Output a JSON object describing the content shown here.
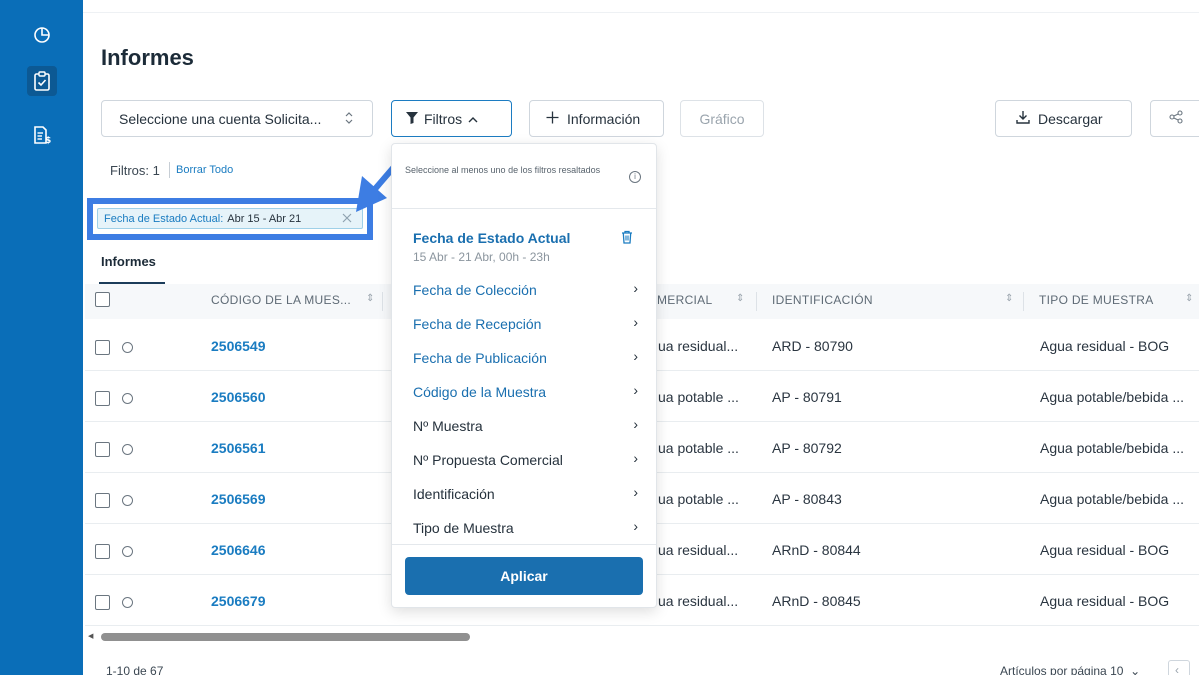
{
  "sidebar": {
    "icons": [
      "chart-pie-icon",
      "clipboard-check-icon",
      "invoice-icon"
    ]
  },
  "header": {
    "title": "Informes"
  },
  "toolbar": {
    "account_select": "Seleccione una cuenta Solicita...",
    "filters_label": "Filtros",
    "info_label": "Información",
    "chart_label": "Gráfico",
    "download_label": "Descargar"
  },
  "filters_status": {
    "label": "Filtros: 1",
    "clear_all": "Borrar Todo",
    "chip_key": "Fecha de Estado Actual:",
    "chip_value": "Abr 15 - Abr 21"
  },
  "tabs": [
    {
      "label": "Informes",
      "active": true
    }
  ],
  "table": {
    "columns": [
      "CÓDIGO DE LA MUES...",
      "MERCIAL",
      "IDENTIFICACIÓN",
      "TIPO DE MUESTRA"
    ],
    "rows": [
      {
        "code": "2506549",
        "commercial": "ua residual...",
        "identification": "ARD - 80790",
        "sample_type": "Agua residual - BOG"
      },
      {
        "code": "2506560",
        "commercial": "ua potable ...",
        "identification": "AP - 80791",
        "sample_type": "Agua potable/bebida ..."
      },
      {
        "code": "2506561",
        "commercial": "ua potable ...",
        "identification": "AP - 80792",
        "sample_type": "Agua potable/bebida ..."
      },
      {
        "code": "2506569",
        "commercial": "ua potable ...",
        "identification": "AP - 80843",
        "sample_type": "Agua potable/bebida ..."
      },
      {
        "code": "2506646",
        "commercial": "ua residual...",
        "identification": "ARnD - 80844",
        "sample_type": "Agua residual - BOG"
      },
      {
        "code": "2506679",
        "commercial": "ua residual...",
        "identification": "ARnD - 80845",
        "sample_type": "Agua residual - BOG"
      }
    ]
  },
  "footer": {
    "count": "1-10 de 67",
    "per_page": "Artículos por página 10"
  },
  "filter_dropdown": {
    "hint": "Seleccione al menos uno de los filtros resaltados",
    "active_filter": {
      "title": "Fecha de Estado Actual",
      "subtitle": "15 Abr - 21 Abr, 00h - 23h"
    },
    "items": [
      {
        "label": "Fecha de Colección",
        "highlighted": true
      },
      {
        "label": "Fecha de Recepción",
        "highlighted": true
      },
      {
        "label": "Fecha de Publicación",
        "highlighted": true
      },
      {
        "label": "Código de la Muestra",
        "highlighted": true
      },
      {
        "label": "Nº Muestra",
        "highlighted": false
      },
      {
        "label": "Nº Propuesta Comercial",
        "highlighted": false
      },
      {
        "label": "Identificación",
        "highlighted": false
      },
      {
        "label": "Tipo de Muestra",
        "highlighted": false
      }
    ],
    "apply_label": "Aplicar"
  },
  "colors": {
    "sidebar": "#0a6eb8",
    "primary": "#1a6faf",
    "link": "#1a7cc1",
    "annotation": "#3d7de3"
  }
}
